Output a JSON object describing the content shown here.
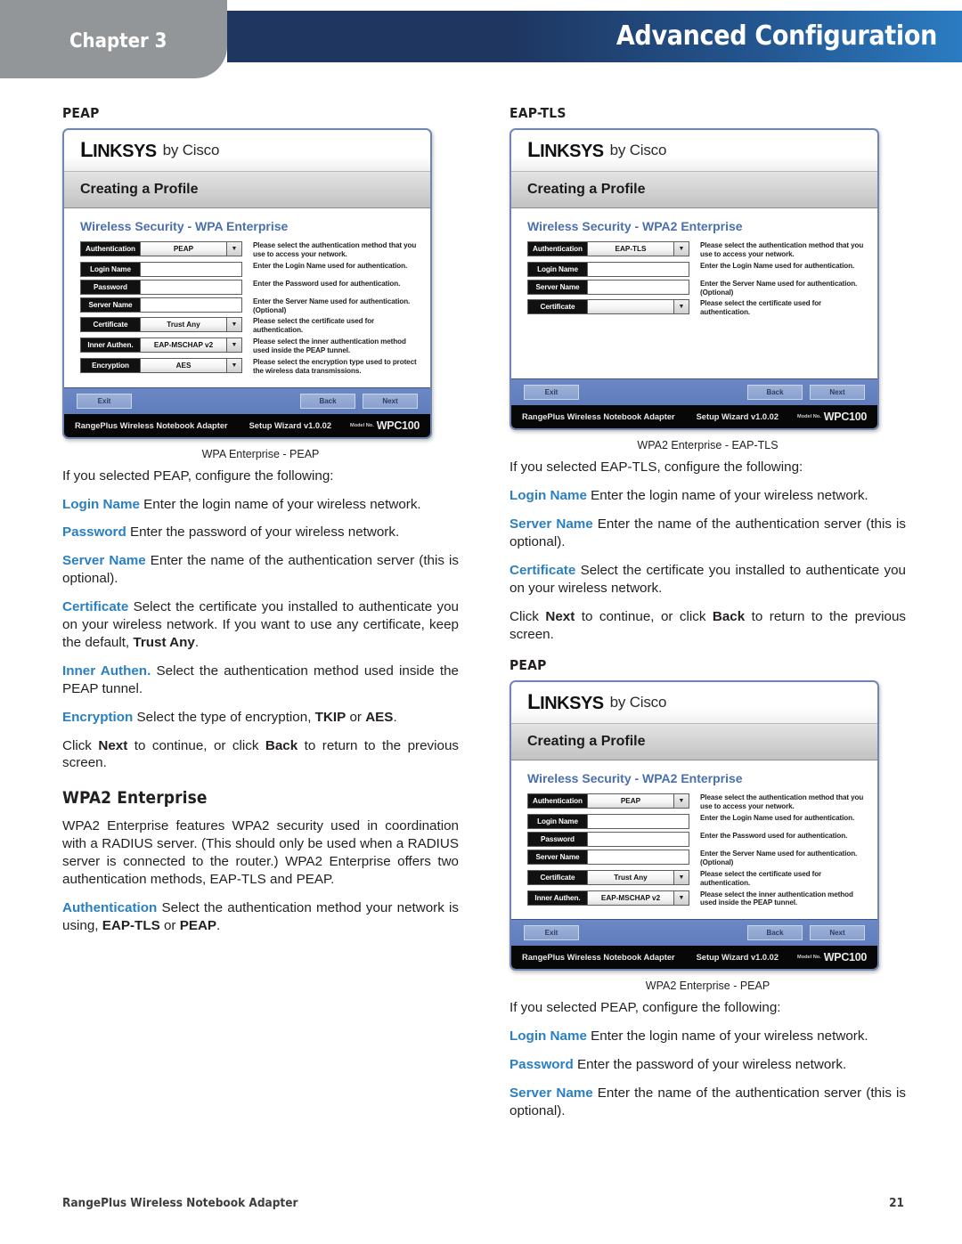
{
  "header": {
    "chapter_label": "Chapter 3",
    "title": "Advanced Configuration",
    "band_color_left": "#1e3660",
    "band_color_right": "#2b7cc2",
    "tab_color": "#939699"
  },
  "accent_color": "#2a7fc0",
  "left_column": {
    "section_heading": "PEAP",
    "figure": {
      "caption": "WPA Enterprise - PEAP",
      "logo_brand": "LINKSYS",
      "logo_suffix": "by Cisco",
      "window_title": "Creating a Profile",
      "security_heading": "Wireless Security - WPA Enterprise",
      "rows": [
        {
          "label": "Authentication",
          "value": "PEAP",
          "type": "select",
          "help": "Please select the authentication method that you use to access your network."
        },
        {
          "label": "Login Name",
          "value": "",
          "type": "text",
          "help": "Enter the Login Name used for authentication."
        },
        {
          "label": "Password",
          "value": "",
          "type": "text",
          "help": "Enter the Password used for authentication."
        },
        {
          "label": "Server Name",
          "value": "",
          "type": "text",
          "help": "Enter the Server Name used for authentication.",
          "help_bold": "(Optional)"
        },
        {
          "label": "Certificate",
          "value": "Trust Any",
          "type": "select",
          "help": "Please select the certificate used for authentication."
        },
        {
          "label": "Inner Authen.",
          "value": "EAP-MSCHAP v2",
          "type": "select",
          "help": "Please select the inner authentication method used inside the PEAP tunnel."
        },
        {
          "label": "Encryption",
          "value": "AES",
          "type": "select",
          "help": "Please select the encryption type used to protect the wireless data transmissions."
        }
      ],
      "buttons": {
        "exit": "Exit",
        "back": "Back",
        "next": "Next"
      },
      "status": {
        "adapter": "RangePlus Wireless Notebook Adapter",
        "wizard": "Setup Wizard v1.0.02",
        "model_label": "Model No.",
        "model": "WPC100"
      }
    },
    "intro": "If you selected PEAP, configure the following:",
    "items": [
      {
        "term": "Login Name",
        "text": " Enter the login name of your wireless network."
      },
      {
        "term": "Password",
        "text": "  Enter the password of your wireless network."
      },
      {
        "term": "Server Name",
        "text": "  Enter the name of the authentication server (this is optional)."
      },
      {
        "term": "Certificate",
        "text": " Select the certificate you installed to authenticate you on your wireless network. If you want to use any certificate, keep the default, ",
        "bold_tail": "Trust Any",
        "tail": "."
      },
      {
        "term": "Inner Authen.",
        "text": " Select the authentication method used inside the PEAP tunnel."
      },
      {
        "term": "Encryption",
        "text": "  Select the type of encryption, ",
        "bold_tail": "TKIP",
        "mid": " or ",
        "bold_tail2": "AES",
        "tail": "."
      }
    ],
    "click_note": {
      "pre": "Click ",
      "b1": "Next",
      "mid": " to continue, or click ",
      "b2": "Back",
      "post": " to return to the previous screen."
    },
    "sub_heading": "WPA2 Enterprise",
    "sub_paragraph": "WPA2 Enterprise features WPA2 security used in coordination with a RADIUS server. (This should only be used when a RADIUS server is connected to the router.) WPA2 Enterprise offers two authentication methods, EAP-TLS and PEAP.",
    "auth_item": {
      "term": "Authentication",
      "text": " Select the authentication method your network is using, ",
      "bold_tail": "EAP-TLS",
      "mid": " or ",
      "bold_tail2": "PEAP",
      "tail": "."
    }
  },
  "right_column": {
    "section_heading": "EAP-TLS",
    "figure": {
      "caption": "WPA2 Enterprise - EAP-TLS",
      "logo_brand": "LINKSYS",
      "logo_suffix": "by Cisco",
      "window_title": "Creating a Profile",
      "security_heading": "Wireless Security - WPA2 Enterprise",
      "rows": [
        {
          "label": "Authentication",
          "value": "EAP-TLS",
          "type": "select",
          "help": "Please select the authentication method that you use to access your network."
        },
        {
          "label": "Login Name",
          "value": "",
          "type": "text",
          "help": "Enter the Login Name used for authentication."
        },
        {
          "label": "Server Name",
          "value": "",
          "type": "text",
          "help": "Enter the Server Name used for authentication.",
          "help_bold": "(Optional)"
        },
        {
          "label": "Certificate",
          "value": "",
          "type": "select",
          "help": "Please select the certificate used for authentication."
        }
      ],
      "buttons": {
        "exit": "Exit",
        "back": "Back",
        "next": "Next"
      },
      "status": {
        "adapter": "RangePlus Wireless Notebook Adapter",
        "wizard": "Setup Wizard v1.0.02",
        "model_label": "Model No.",
        "model": "WPC100"
      }
    },
    "intro": "If you selected EAP-TLS, configure the following:",
    "items": [
      {
        "term": "Login Name",
        "text": " Enter the login name of your wireless network."
      },
      {
        "term": "Server Name",
        "text": "  Enter the name of the authentication server (this is optional)."
      },
      {
        "term": "Certificate",
        "text": " Select the certificate you installed to authenticate you on your wireless network."
      }
    ],
    "click_note": {
      "pre": "Click ",
      "b1": "Next",
      "mid": " to continue, or click ",
      "b2": "Back",
      "post": " to return to the previous screen."
    },
    "second_section_heading": "PEAP",
    "figure2": {
      "caption": "WPA2 Enterprise - PEAP",
      "logo_brand": "LINKSYS",
      "logo_suffix": "by Cisco",
      "window_title": "Creating a Profile",
      "security_heading": "Wireless Security - WPA2 Enterprise",
      "rows": [
        {
          "label": "Authentication",
          "value": "PEAP",
          "type": "select",
          "help": "Please select the authentication method that you use to access your network."
        },
        {
          "label": "Login Name",
          "value": "",
          "type": "text",
          "help": "Enter the Login Name used for authentication."
        },
        {
          "label": "Password",
          "value": "",
          "type": "text",
          "help": "Enter the Password used for authentication."
        },
        {
          "label": "Server Name",
          "value": "",
          "type": "text",
          "help": "Enter the Server Name used for authentication.",
          "help_bold": "(Optional)"
        },
        {
          "label": "Certificate",
          "value": "Trust Any",
          "type": "select",
          "help": "Please select the certificate used for authentication."
        },
        {
          "label": "Inner Authen.",
          "value": "EAP-MSCHAP v2",
          "type": "select",
          "help": "Please select the inner authentication method used inside the PEAP tunnel."
        }
      ],
      "buttons": {
        "exit": "Exit",
        "back": "Back",
        "next": "Next"
      },
      "status": {
        "adapter": "RangePlus Wireless Notebook Adapter",
        "wizard": "Setup Wizard v1.0.02",
        "model_label": "Model No.",
        "model": "WPC100"
      }
    },
    "intro2": "If you selected PEAP, configure the following:",
    "items2": [
      {
        "term": "Login Name",
        "text": " Enter the login name of your wireless network."
      },
      {
        "term": "Password",
        "text": "  Enter the password of your wireless network."
      },
      {
        "term": "Server Name",
        "text": "  Enter the name of the authentication server (this is optional)."
      }
    ]
  },
  "footer": {
    "left": "RangePlus Wireless Notebook Adapter",
    "page_number": "21"
  }
}
